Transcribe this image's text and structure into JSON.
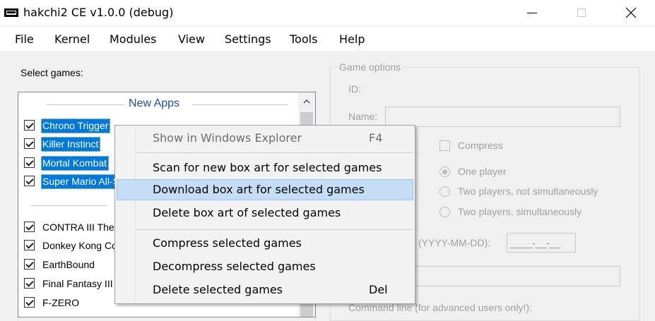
{
  "window": {
    "title": "hakchi2 CE v1.0.0 (debug)"
  },
  "menu": [
    "File",
    "Kernel",
    "Modules",
    "View",
    "Settings",
    "Tools",
    "Help"
  ],
  "left": {
    "select_label": "Select games:",
    "group_title": "New Apps",
    "new_apps": [
      "Chrono Trigger",
      "Killer Instinct",
      "Mortal Kombat",
      "Super Mario All-Stars"
    ],
    "games": [
      "CONTRA III The Alien Wars",
      "Donkey Kong Country",
      "EarthBound",
      "Final Fantasy III",
      "F-ZERO"
    ]
  },
  "options": {
    "legend": "Game options",
    "id_label": "ID:",
    "name_label": "Name:",
    "compress_label": "Compress",
    "radio_one": "One player",
    "radio_two_not_sim": "Two players, not simultaneously",
    "radio_two_sim": "Two players, simultaneously",
    "date_label": "(YYYY-MM-DD):",
    "date_value": "____-__-__",
    "cmdline_label": "Command line (for advanced users only!):"
  },
  "context_menu": {
    "show_explorer": "Show in Windows Explorer",
    "show_explorer_key": "F4",
    "scan_box_art": "Scan for new box art for selected games",
    "download_box_art": "Download box art for selected games",
    "delete_box_art": "Delete box art of selected games",
    "compress": "Compress selected games",
    "decompress": "Decompress selected games",
    "delete_games": "Delete selected games",
    "delete_games_key": "Del"
  },
  "colors": {
    "selection": "#0078d7",
    "menu_highlight": "#c6def5",
    "group_title": "#1e4e9c"
  }
}
